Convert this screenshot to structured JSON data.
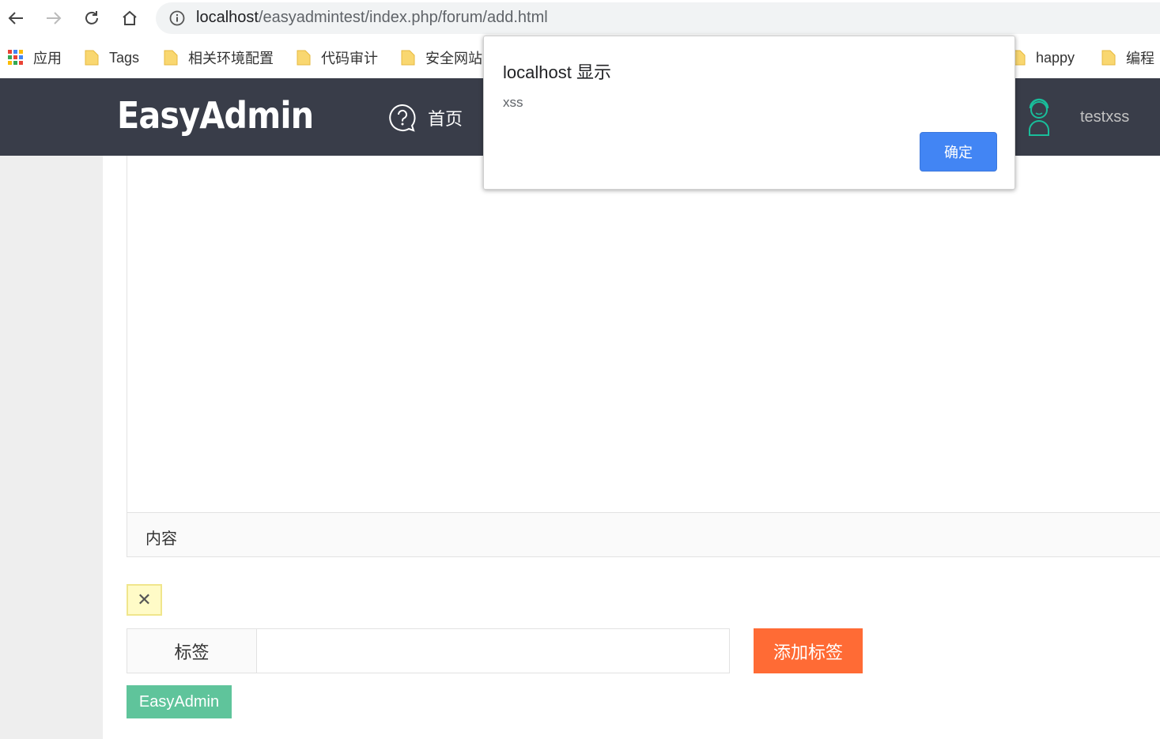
{
  "browser": {
    "url_host": "localhost",
    "url_path": "/easyadmintest/index.php/forum/add.html"
  },
  "bookmarks": [
    {
      "label": "应用",
      "icon": "apps-grid-icon"
    },
    {
      "label": "Tags",
      "icon": "folder-icon"
    },
    {
      "label": "相关环境配置",
      "icon": "folder-icon"
    },
    {
      "label": "代码审计",
      "icon": "folder-icon"
    },
    {
      "label": "安全网站",
      "icon": "folder-icon"
    },
    {
      "label": "happy",
      "icon": "folder-icon"
    },
    {
      "label": "编程",
      "icon": "folder-icon"
    }
  ],
  "header": {
    "logo": "EasyAdmin",
    "nav_home": "首页",
    "username": "testxss"
  },
  "editor": {
    "footer_label": "内容"
  },
  "tags": {
    "close_symbol": "✕",
    "label": "标签",
    "input_value": "",
    "add_button": "添加标签",
    "chip": "EasyAdmin"
  },
  "dialog": {
    "title": "localhost 显示",
    "message": "xss",
    "ok_button": "确定"
  },
  "colors": {
    "header_bg": "#393d49",
    "add_button": "#ff6b35",
    "chip": "#5fc49b",
    "dialog_ok": "#4285f4"
  }
}
